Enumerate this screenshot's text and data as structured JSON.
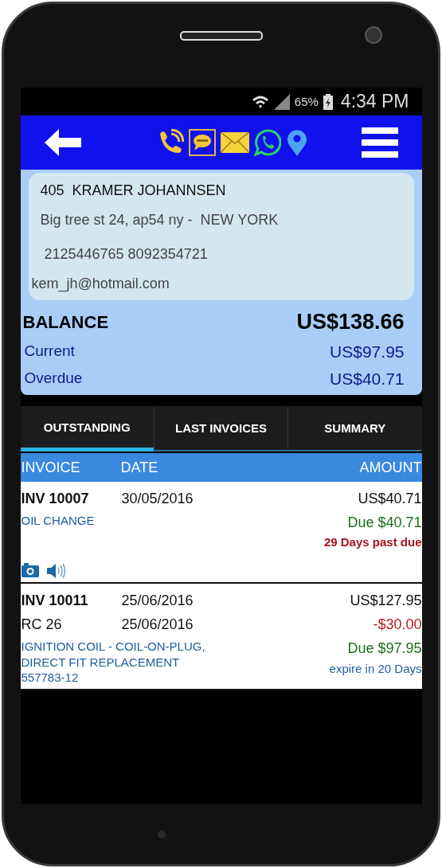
{
  "status_bar": {
    "battery": "65%",
    "time": "4:34 PM"
  },
  "contact": {
    "name": "405  KRAMER JOHANNSEN",
    "address": "Big tree st 24, ap54 ny -  NEW YORK",
    "phones": "2125446765 8092354721",
    "email": "kem_jh@hotmail.com"
  },
  "balance": {
    "label": "BALANCE",
    "amount": "US$138.66",
    "lines": [
      {
        "label": "Current",
        "amount": "US$97.95"
      },
      {
        "label": "Overdue",
        "amount": "US$40.71"
      }
    ]
  },
  "tabs": [
    {
      "label": "OUTSTANDING",
      "selected": true
    },
    {
      "label": "LAST INVOICES",
      "selected": false
    },
    {
      "label": "SUMMARY",
      "selected": false
    }
  ],
  "table": {
    "columns": [
      "INVOICE",
      "DATE",
      "AMOUNT"
    ],
    "rows": [
      {
        "entries": [
          {
            "kind": "invoice",
            "ref": "INV 10007",
            "date": "30/05/2016",
            "amount": "US$40.71"
          }
        ],
        "description": "OIL CHANGE",
        "due": "Due $40.71",
        "note": {
          "kind": "overdue",
          "text": "29 Days past due"
        },
        "attachments": true
      },
      {
        "entries": [
          {
            "kind": "invoice",
            "ref": "INV 10011",
            "date": "25/06/2016",
            "amount": "US$127.95"
          },
          {
            "kind": "credit",
            "ref": "RC 26",
            "date": "25/06/2016",
            "amount": "-$30.00"
          }
        ],
        "description": "IGNITION COIL - COIL-ON-PLUG, DIRECT FIT REPLACEMENT 557783-12",
        "due": "Due $97.95",
        "note": {
          "kind": "expiry",
          "text": "expire in 20 Days"
        },
        "attachments": false
      }
    ]
  }
}
